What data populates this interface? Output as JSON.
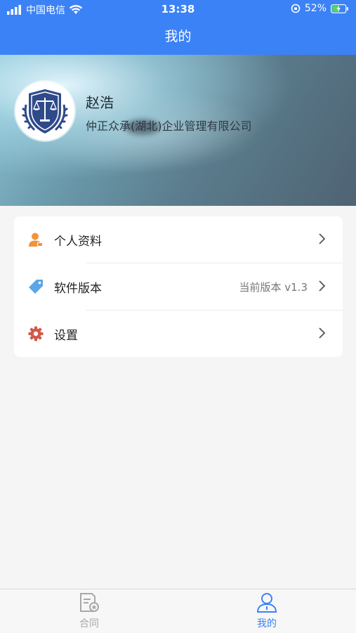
{
  "status_bar": {
    "carrier": "中国电信",
    "time": "13:38",
    "battery": "52%"
  },
  "nav": {
    "title": "我的"
  },
  "profile": {
    "name": "赵浩",
    "company": "仲正众承(湖北)企业管理有限公司"
  },
  "menu": {
    "items": [
      {
        "label": "个人资料",
        "value": "",
        "icon": "user-profile-icon",
        "color": "#f0943b"
      },
      {
        "label": "软件版本",
        "value": "当前版本 v1.3",
        "icon": "tag-icon",
        "color": "#5aa6e6"
      },
      {
        "label": "设置",
        "value": "",
        "icon": "gear-icon",
        "color": "#d05a4a"
      }
    ]
  },
  "tabbar": {
    "tabs": [
      {
        "label": "合同",
        "icon": "contract-icon",
        "active": false
      },
      {
        "label": "我的",
        "icon": "person-icon",
        "active": true
      }
    ],
    "active_color": "#3b82f6",
    "inactive_color": "#a8a8a8"
  }
}
